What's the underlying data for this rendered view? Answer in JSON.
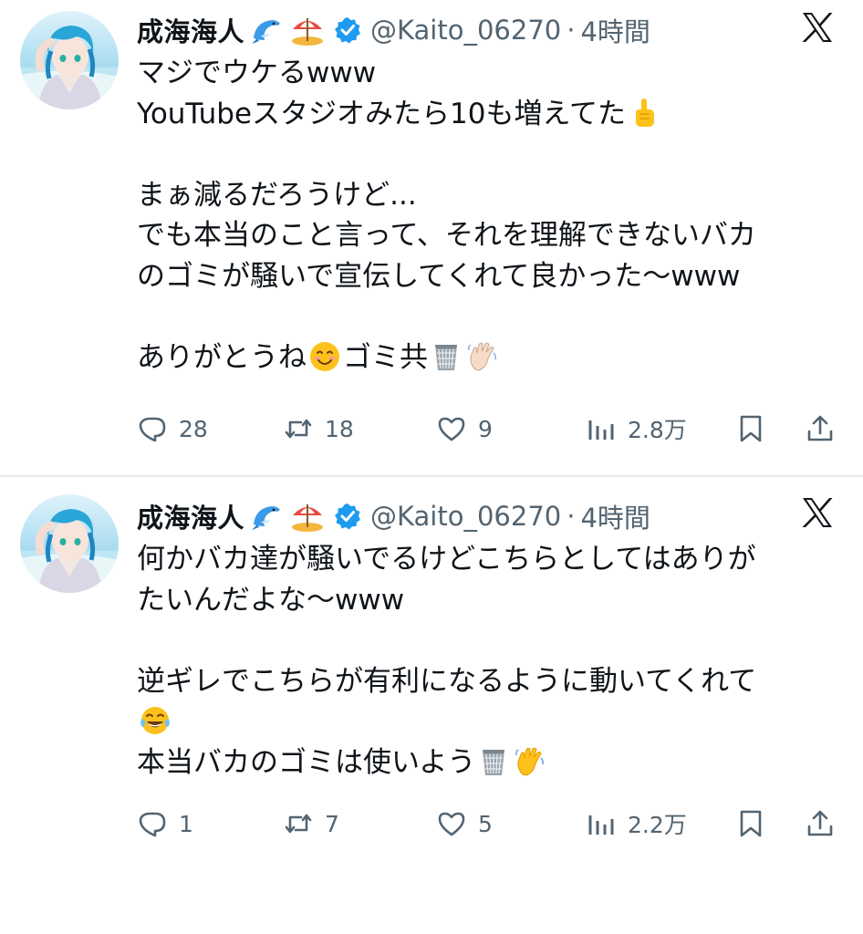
{
  "tweets": [
    {
      "author": {
        "name": "成海海人",
        "handle": "@Kaito_06270",
        "separator": "·",
        "time": "4時間"
      },
      "lines": [
        [
          "マジでウケるwww"
        ],
        [
          "YouTubeスタジオみたら10も増えてた",
          "{emoji:pointing-up}"
        ],
        [
          ""
        ],
        [
          "まぁ減るだろうけど..."
        ],
        [
          "でも本当のこと言って、それを理解できないバカ"
        ],
        [
          "のゴミが騒いで宣伝してくれて良かった〜www"
        ],
        [
          ""
        ],
        [
          "ありがとうね",
          "{emoji:smiling-face}",
          "ゴミ共",
          "{emoji:wastebasket}",
          "{emoji:waving-hand-light}"
        ]
      ],
      "metrics": {
        "replies": "28",
        "retweets": "18",
        "likes": "9",
        "views": "2.8万"
      }
    },
    {
      "author": {
        "name": "成海海人",
        "handle": "@Kaito_06270",
        "separator": "·",
        "time": "4時間"
      },
      "lines": [
        [
          "何かバカ達が騒いでるけどこちらとしてはありが"
        ],
        [
          "たいんだよな〜www"
        ],
        [
          ""
        ],
        [
          "逆ギレでこちらが有利になるように動いてくれて"
        ],
        [
          "{emoji:tears-of-joy}"
        ],
        [
          "本当バカのゴミは使いよう",
          "{emoji:wastebasket}",
          "{emoji:waving-hand}"
        ]
      ],
      "metrics": {
        "replies": "1",
        "retweets": "7",
        "likes": "5",
        "views": "2.2万"
      }
    }
  ],
  "icons": {
    "name_emojis": [
      "dolphin-icon",
      "beach-umbrella-island-icon"
    ],
    "verified": "verified-badge-icon",
    "brand": "x-logo-icon",
    "actions": [
      "reply-icon",
      "retweet-icon",
      "like-icon",
      "views-icon",
      "bookmark-icon",
      "share-icon"
    ]
  },
  "colors": {
    "text": "#0f1419",
    "secondary": "#536471",
    "verified": "#1d9bf0",
    "divider": "#e4e7ea"
  }
}
